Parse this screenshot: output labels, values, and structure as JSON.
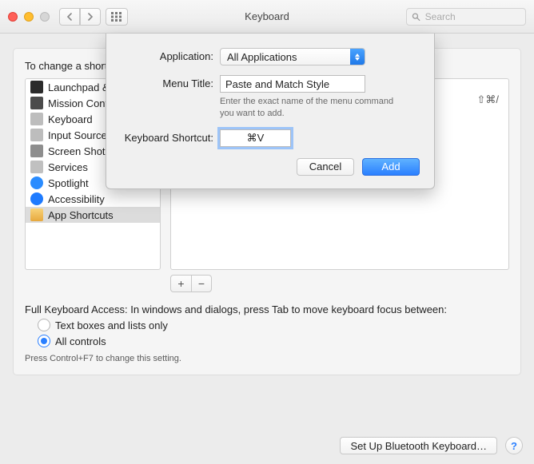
{
  "window": {
    "title": "Keyboard",
    "search_placeholder": "Search"
  },
  "intro_text": "To change a shortcut, select it, double-click the key combination, then type the new keys.",
  "sidebar": {
    "items": [
      {
        "label": "Launchpad & Dock"
      },
      {
        "label": "Mission Control"
      },
      {
        "label": "Keyboard"
      },
      {
        "label": "Input Sources"
      },
      {
        "label": "Screen Shots"
      },
      {
        "label": "Services"
      },
      {
        "label": "Spotlight"
      },
      {
        "label": "Accessibility"
      },
      {
        "label": "App Shortcuts"
      }
    ],
    "selected_index": 8
  },
  "detail": {
    "displayed_shortcut": "⇧⌘/"
  },
  "fka": {
    "note": "Full Keyboard Access: In windows and dialogs, press Tab to move keyboard focus between:",
    "option_text_lists": "Text boxes and lists only",
    "option_all": "All controls",
    "hint": "Press Control+F7 to change this setting."
  },
  "footer": {
    "bluetooth_label": "Set Up Bluetooth Keyboard…"
  },
  "sheet": {
    "labels": {
      "application": "Application:",
      "menu_title": "Menu Title:",
      "keyboard_shortcut": "Keyboard Shortcut:"
    },
    "application_selected": "All Applications",
    "menu_title_value": "Paste and Match Style",
    "menu_title_help": "Enter the exact name of the menu command you want to add.",
    "shortcut_value": "⌘V",
    "cancel_label": "Cancel",
    "add_label": "Add"
  }
}
